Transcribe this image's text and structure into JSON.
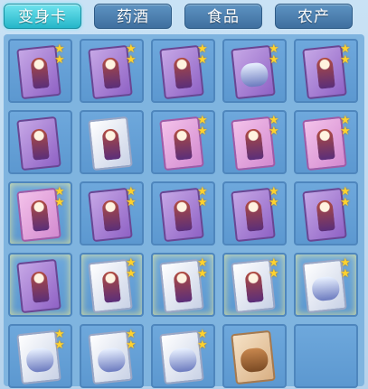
{
  "tabs": [
    {
      "label": "变身卡",
      "active": true
    },
    {
      "label": "药酒",
      "active": false
    },
    {
      "label": "食品",
      "active": false
    },
    {
      "label": "农产",
      "active": false
    }
  ],
  "items": [
    {
      "card": "purple",
      "figure": "hero",
      "stars": 2,
      "glow": false
    },
    {
      "card": "purple",
      "figure": "hero",
      "stars": 2,
      "glow": false
    },
    {
      "card": "purple",
      "figure": "hero",
      "stars": 2,
      "glow": false
    },
    {
      "card": "purple",
      "figure": "creature",
      "stars": 2,
      "glow": false
    },
    {
      "card": "purple",
      "figure": "hero",
      "stars": 2,
      "glow": false
    },
    {
      "card": "purple",
      "figure": "hero",
      "stars": 0,
      "glow": false
    },
    {
      "card": "silver",
      "figure": "hero",
      "stars": 0,
      "glow": false
    },
    {
      "card": "pink",
      "figure": "hero",
      "stars": 2,
      "glow": false
    },
    {
      "card": "pink",
      "figure": "hero",
      "stars": 2,
      "glow": false
    },
    {
      "card": "pink",
      "figure": "hero",
      "stars": 2,
      "glow": false
    },
    {
      "card": "pink",
      "figure": "hero",
      "stars": 2,
      "glow": true
    },
    {
      "card": "purple",
      "figure": "hero",
      "stars": 2,
      "glow": false
    },
    {
      "card": "purple",
      "figure": "hero",
      "stars": 2,
      "glow": false
    },
    {
      "card": "purple",
      "figure": "hero",
      "stars": 2,
      "glow": false
    },
    {
      "card": "purple",
      "figure": "hero",
      "stars": 2,
      "glow": false
    },
    {
      "card": "purple",
      "figure": "hero",
      "stars": 0,
      "glow": true
    },
    {
      "card": "silver",
      "figure": "hero",
      "stars": 2,
      "glow": true
    },
    {
      "card": "silver",
      "figure": "hero",
      "stars": 2,
      "glow": true
    },
    {
      "card": "silver",
      "figure": "hero",
      "stars": 2,
      "glow": true
    },
    {
      "card": "silver",
      "figure": "creature",
      "stars": 2,
      "glow": true
    },
    {
      "card": "silver",
      "figure": "creature",
      "stars": 2,
      "glow": false
    },
    {
      "card": "silver",
      "figure": "creature",
      "stars": 2,
      "glow": false
    },
    {
      "card": "silver",
      "figure": "creature",
      "stars": 2,
      "glow": false
    },
    {
      "card": "brown",
      "figure": "bear",
      "stars": 0,
      "glow": false
    },
    {
      "card": "",
      "figure": "",
      "stars": 0,
      "glow": false
    }
  ]
}
